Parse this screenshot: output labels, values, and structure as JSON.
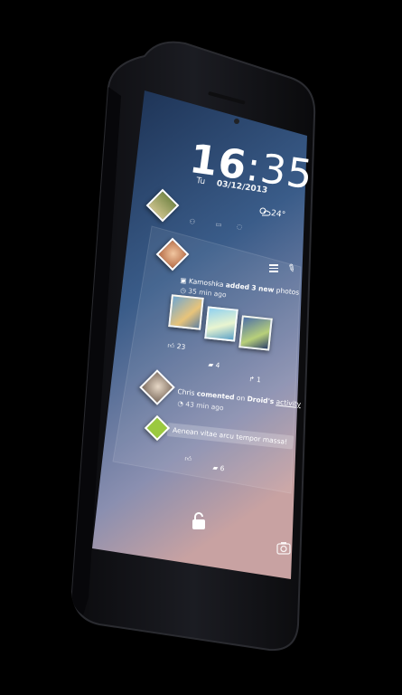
{
  "status": {
    "time_hours": "16",
    "time_colon": ":",
    "time_minutes": "35",
    "day": "Tu",
    "date": "03/12/2013",
    "temperature": "24°"
  },
  "feed": {
    "post1": {
      "author": "Kamoshka",
      "action": "added",
      "object": "3 new",
      "object_suffix": "photos",
      "time": "35 min ago",
      "likes": "23",
      "comments": "4",
      "shares": "1"
    },
    "post2": {
      "author": "Chris",
      "action": "comented",
      "on": "on",
      "target": "Droid's",
      "target_suffix": "activity",
      "time": "43 min ago",
      "quote": "Aenean vitae arcu tempor massa!",
      "likes": "",
      "comments": "6"
    }
  },
  "colors": {
    "screen_top": "#1d3558",
    "screen_mid": "#3b5d8a",
    "screen_bottom": "#c09aa3",
    "phone_body": "#141519",
    "accent": "#ffffff"
  },
  "icons": [
    "lock-icon",
    "camera-icon",
    "weather-icon",
    "menu-icon",
    "pencil-icon",
    "like-icon",
    "comment-icon",
    "share-icon",
    "image-icon",
    "clock-icon",
    "android-icon"
  ]
}
